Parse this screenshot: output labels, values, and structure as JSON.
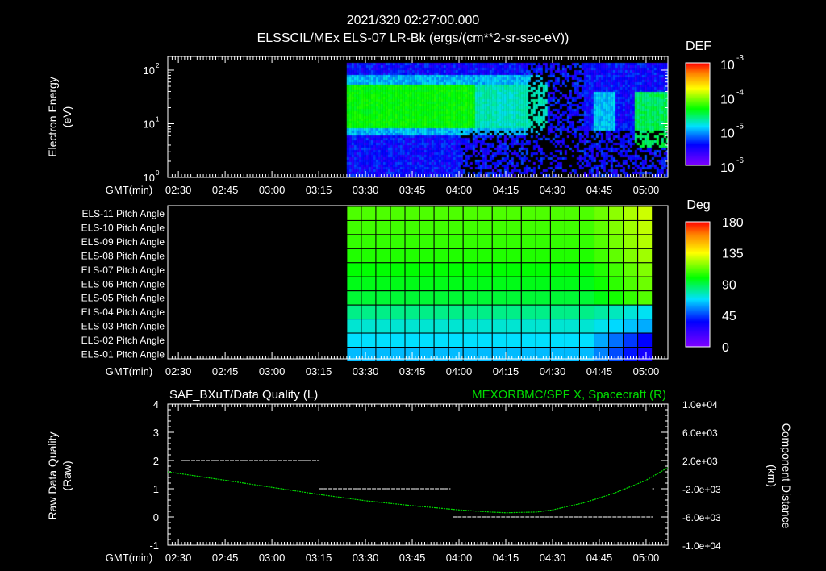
{
  "title": "2021/320 02:27:00.000",
  "chart_data": [
    {
      "type": "heatmap",
      "title": "ELSSCIL/MEx ELS-07 LR-Bk  (ergs/(cm**2-sr-sec-eV))",
      "ylabel": "Electron Energy",
      "ylabel2": "(eV)",
      "yscale": "log",
      "ylim": [
        1,
        180
      ],
      "yticks": [
        "10",
        "10",
        "10"
      ],
      "ytick_exp": [
        "0",
        "1",
        "2"
      ],
      "xlabel": "GMT(min)",
      "xticks": [
        "02:30",
        "02:45",
        "03:00",
        "03:15",
        "03:30",
        "03:45",
        "04:00",
        "04:15",
        "04:30",
        "04:45",
        "05:00"
      ],
      "xlim_min": [
        146.6,
        307
      ],
      "data_start_min": 204,
      "colorbar": {
        "label": "DEF",
        "ticks": [
          "10",
          "10",
          "10",
          "10"
        ],
        "tick_exp": [
          "-3",
          "-4",
          "-5",
          "-6"
        ],
        "range": [
          1e-06,
          0.001
        ]
      },
      "features": "Green band ~8-40 eV from 03:24 to 04:07, fading; enhanced band 4-30 eV after 04:56"
    },
    {
      "type": "heatmap",
      "title": "ELS Pitch Angle",
      "rows": [
        "ELS-11 Pitch Angle",
        "ELS-10 Pitch Angle",
        "ELS-09 Pitch Angle",
        "ELS-08 Pitch Angle",
        "ELS-07 Pitch Angle",
        "ELS-06 Pitch Angle",
        "ELS-05 Pitch Angle",
        "ELS-04 Pitch Angle",
        "ELS-03 Pitch Angle",
        "ELS-02 Pitch Angle",
        "ELS-01 Pitch Angle"
      ],
      "row_pitch_deg": [
        112,
        110,
        108,
        105,
        100,
        97,
        93,
        82,
        72,
        66,
        60
      ],
      "data_start_min": 204,
      "data_end_min": 302,
      "ncols": 21,
      "xlabel": "GMT(min)",
      "xticks": [
        "02:30",
        "02:45",
        "03:00",
        "03:15",
        "03:30",
        "03:45",
        "04:00",
        "04:15",
        "04:30",
        "04:45",
        "05:00"
      ],
      "colorbar": {
        "label": "Deg",
        "ticks": [
          "180",
          "135",
          "90",
          "45",
          "0"
        ],
        "range": [
          0,
          180
        ]
      }
    },
    {
      "type": "line",
      "title_left": "SAF_BXuT/Data Quality (L)",
      "title_right": "MEXORBMC/SPF X, Spacecraft (R)",
      "ylabel_left": "Raw Data Quality",
      "ylabel_left2": "(Raw)",
      "ylim_left": [
        -1,
        4
      ],
      "yticks_left": [
        "4",
        "3",
        "2",
        "1",
        "0",
        "-1"
      ],
      "ylabel_right": "Component Distance",
      "ylabel_right2": "(km)",
      "ylim_right": [
        -10000,
        10000
      ],
      "yticks_right": [
        "1.0e+04",
        "6.0e+03",
        "2.0e+03",
        "-2.0e+03",
        "-6.0e+03",
        "-1.0e+04"
      ],
      "xlabel": "GMT(min)",
      "xticks": [
        "02:30",
        "02:45",
        "03:00",
        "03:15",
        "03:30",
        "03:45",
        "04:00",
        "04:15",
        "04:30",
        "04:45",
        "05:00"
      ],
      "quality_segments": [
        {
          "from": 151,
          "to": 195,
          "value": 2
        },
        {
          "from": 195,
          "to": 237,
          "value": 1
        },
        {
          "from": 238,
          "to": 302,
          "value": 0
        },
        {
          "from": 302,
          "to": 302.3,
          "value": 1
        }
      ],
      "spf_x": {
        "x": [
          146.6,
          165,
          180,
          195,
          210,
          225,
          240,
          250,
          255,
          265,
          270,
          280,
          290,
          300,
          307
        ],
        "y": [
          400,
          -800,
          -1800,
          -2800,
          -3700,
          -4400,
          -5000,
          -5300,
          -5400,
          -5300,
          -5000,
          -4000,
          -2600,
          -800,
          1000
        ],
        "color": "#00dd00"
      }
    }
  ]
}
